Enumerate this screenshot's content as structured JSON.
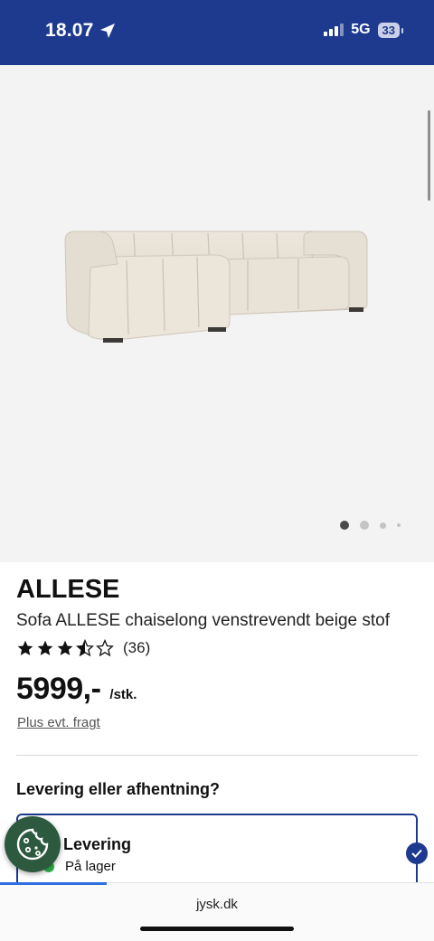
{
  "status_bar": {
    "time": "18.07",
    "network": "5G",
    "battery": "33"
  },
  "gallery": {
    "image_alt": "sofa-image",
    "dot_count": 4,
    "active_index": 0
  },
  "product": {
    "brand": "ALLESE",
    "name": "Sofa ALLESE chaiselong venstrevendt beige stof",
    "rating": 3.5,
    "rating_max": 5,
    "review_count": "(36)",
    "price": "5999,-",
    "price_unit": "/stk.",
    "freight_note": "Plus evt. fragt"
  },
  "delivery": {
    "section_title": "Levering eller afhentning?",
    "option_title": "Levering",
    "stock_status": "På lager",
    "stock_color": "#2fb34a",
    "selected": true
  },
  "browser": {
    "url": "jysk.dk",
    "load_progress": 0.25
  },
  "colors": {
    "brand_blue": "#1d3a8f",
    "cookie_green": "#2d5a3f",
    "progress_blue": "#2f6fe0"
  },
  "icons": {
    "location": "location-arrow-icon",
    "cookie": "cookie-icon",
    "check": "check-icon",
    "star": "star-icon"
  }
}
